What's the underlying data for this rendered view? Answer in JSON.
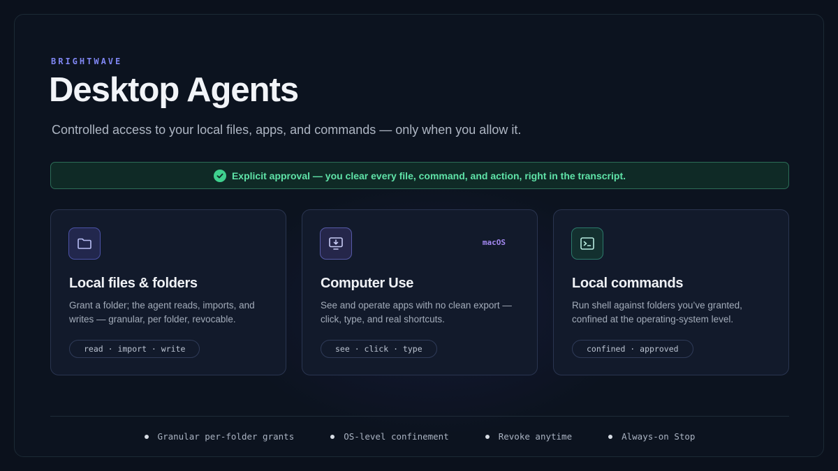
{
  "header": {
    "eyebrow": "BRIGHTWAVE",
    "title": "Desktop Agents",
    "subtitle": "Controlled access to your local files, apps, and commands — only when you allow it."
  },
  "banner": {
    "icon": "check-circle-icon",
    "text": "Explicit approval — you clear every file, command, and action, right in the transcript."
  },
  "cards": [
    {
      "icon": "folder-icon",
      "title": "Local files & folders",
      "description": "Grant a folder; the agent reads, imports, and writes — granular, per folder, revocable.",
      "pill": "read · import · write"
    },
    {
      "icon": "monitor-download-icon",
      "tag": "macOS",
      "title": "Computer Use",
      "description": "See and operate apps with no clean export — click, type, and real shortcuts.",
      "pill": "see · click · type"
    },
    {
      "icon": "terminal-icon",
      "title": "Local commands",
      "description": "Run shell against folders you’ve granted, confined at the operating-system level.",
      "pill": "confined · approved"
    }
  ],
  "footer": {
    "items": [
      "Granular per-folder grants",
      "OS-level confinement",
      "Revoke anytime",
      "Always-on Stop"
    ]
  },
  "colors": {
    "accent": "#7f86f2",
    "success": "#3fd18e",
    "background": "#0c131f",
    "card": "#121a2b"
  }
}
